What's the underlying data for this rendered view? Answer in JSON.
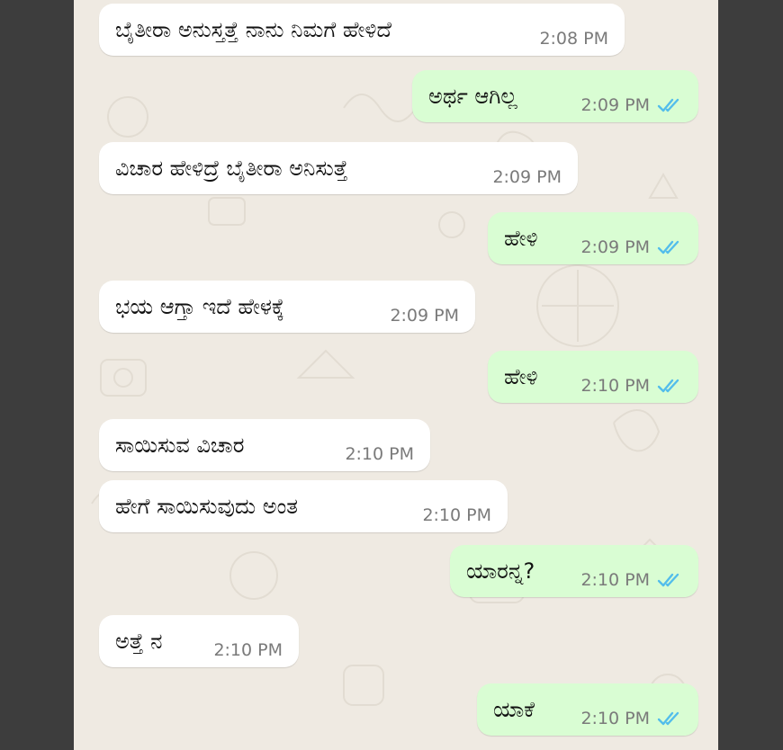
{
  "colors": {
    "incoming_bubble": "#ffffff",
    "outgoing_bubble": "#d9fdd3",
    "chat_background": "#efeae2",
    "read_ticks": "#53bdeb"
  },
  "messages": [
    {
      "direction": "in",
      "text": "ಬೈತೀರಾ ಅನುಸ್ತತ್ತೆ ನಾನು ನಿಮಗೆ ಹೇಳಿದೆ",
      "time": "2:08 PM"
    },
    {
      "direction": "out",
      "text": "ಅರ್ಥ ಆಗಿಲ್ಲ",
      "time": "2:09 PM",
      "status_icon": "double-check-read-icon"
    },
    {
      "direction": "in",
      "text": "ವಿಚಾರ ಹೇಳಿದ್ರೆ ಬೈತೀರಾ ಅನಿಸುತ್ತೆ",
      "time": "2:09 PM"
    },
    {
      "direction": "out",
      "text": "ಹೇಳಿ",
      "time": "2:09 PM",
      "status_icon": "double-check-read-icon"
    },
    {
      "direction": "in",
      "text": "ಭಯ ಆಗ್ತಾ ಇದೆ ಹೇಳಕ್ಕೆ",
      "time": "2:09 PM"
    },
    {
      "direction": "out",
      "text": "ಹೇಳಿ",
      "time": "2:10 PM",
      "status_icon": "double-check-read-icon"
    },
    {
      "direction": "in",
      "text": "ಸಾಯಿಸುವ ವಿಚಾರ",
      "time": "2:10 PM"
    },
    {
      "direction": "in",
      "text": "ಹೇಗೆ ಸಾಯಿಸುವುದು ಅಂತ",
      "time": "2:10 PM"
    },
    {
      "direction": "out",
      "text": "ಯಾರನ್ನ?",
      "time": "2:10 PM",
      "status_icon": "double-check-read-icon"
    },
    {
      "direction": "in",
      "text": "ಅತ್ತೆ ನ",
      "time": "2:10 PM"
    },
    {
      "direction": "out",
      "text": "ಯಾಕೆ",
      "time": "2:10 PM",
      "status_icon": "double-check-read-icon"
    }
  ]
}
